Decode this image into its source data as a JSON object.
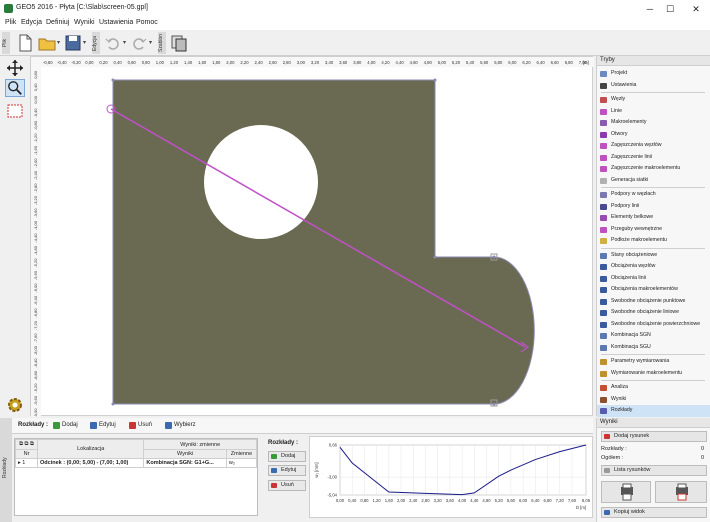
{
  "window": {
    "title": "GEO5 2016 - Płyta [C:\\Slab\\screen-05.gpl]",
    "minimize": "─",
    "maximize": "☐",
    "close": "✕"
  },
  "menu": [
    "Plik",
    "Edycja",
    "Definiuj",
    "Wyniki",
    "Ustawienia",
    "Pomoc"
  ],
  "toolbar": {
    "file_tab": "Plik",
    "edit_tab": "Edycja",
    "template_tab": "Szablon"
  },
  "ruler": {
    "top_ticks": [
      "-0,60",
      "-0,40",
      "-0,20",
      "0,00",
      "0,20",
      "0,40",
      "0,60",
      "0,80",
      "1,00",
      "1,20",
      "1,40",
      "1,60",
      "1,80",
      "2,00",
      "2,20",
      "2,40",
      "2,60",
      "2,80",
      "3,00",
      "3,20",
      "3,40",
      "3,60",
      "3,80",
      "4,00",
      "4,20",
      "4,40",
      "4,60",
      "4,80",
      "5,00",
      "5,20",
      "5,40",
      "5,60",
      "5,80",
      "6,00",
      "6,20",
      "6,40",
      "6,60",
      "6,80",
      "7,00"
    ],
    "top_unit": "[m]",
    "left_ticks": [
      "0,80",
      "0,40",
      "0,00",
      "-0,40",
      "-0,80",
      "-1,20",
      "-1,60",
      "-2,00",
      "-2,40",
      "-2,80",
      "-3,20",
      "-3,60",
      "-4,00",
      "-4,40",
      "-4,80",
      "-5,20",
      "-5,60",
      "-6,00",
      "-6,40",
      "-6,80",
      "-7,20",
      "-7,60",
      "-8,00",
      "-8,40",
      "-8,80",
      "-9,20",
      "-9,60",
      "-10,00"
    ]
  },
  "modes": {
    "header": "Tryby",
    "groups": [
      [
        {
          "label": "Projekt",
          "color": "#6a8ac4"
        },
        {
          "label": "Ustawienia",
          "color": "#444444"
        }
      ],
      [
        {
          "label": "Węzły",
          "color": "#c05050"
        },
        {
          "label": "Linie",
          "color": "#c050c0"
        },
        {
          "label": "Makroelementy",
          "color": "#8a5ab0"
        },
        {
          "label": "Otwory",
          "color": "#8a3ab0"
        },
        {
          "label": "Zagęszczenia węzłów",
          "color": "#c050c0"
        },
        {
          "label": "Zagęszczenie linii",
          "color": "#c050c0"
        },
        {
          "label": "Zagęszczenie makroelementu",
          "color": "#c050c0"
        },
        {
          "label": "Generacja siatki",
          "color": "#b0b0b0"
        }
      ],
      [
        {
          "label": "Podpory w węzłach",
          "color": "#7a7ab0"
        },
        {
          "label": "Podpory linii",
          "color": "#4a4a90"
        },
        {
          "label": "Elementy belkowe",
          "color": "#9a4ab0"
        },
        {
          "label": "Przeguby wewnętrzne",
          "color": "#c050c0"
        },
        {
          "label": "Podłoże makroelementu",
          "color": "#d0b040"
        }
      ],
      [
        {
          "label": "Stany obciążeniowe",
          "color": "#5a7ab0"
        },
        {
          "label": "Obciążenia węzłów",
          "color": "#3a5aa0"
        },
        {
          "label": "Obciążenia linii",
          "color": "#3a5aa0"
        },
        {
          "label": "Obciążenia makroelementów",
          "color": "#3a5aa0"
        },
        {
          "label": "Swobodne obciążenie punktowe",
          "color": "#3a5aa0"
        },
        {
          "label": "Swobodne obciążenie liniowe",
          "color": "#3a5aa0"
        },
        {
          "label": "Swobodne obciążenie powierzchniowe",
          "color": "#3a5aa0"
        },
        {
          "label": "Kombinacja SGN",
          "color": "#5a7ab0"
        },
        {
          "label": "Kombinacja SGU",
          "color": "#5a7ab0"
        }
      ],
      [
        {
          "label": "Parametry wymiarowania",
          "color": "#c09030"
        },
        {
          "label": "Wymiarowanie makroelementu",
          "color": "#c09030"
        }
      ],
      [
        {
          "label": "Analiza",
          "color": "#c05030"
        },
        {
          "label": "Wyniki",
          "color": "#8a5030"
        },
        {
          "label": "Rozkłady",
          "color": "#5a5ab0",
          "active": true
        }
      ]
    ]
  },
  "bottom": {
    "side_label": "Rozkłady",
    "toolbar": {
      "title": "Rozkłady :",
      "add": "Dodaj",
      "edit": "Edytuj",
      "delete": "Usuń",
      "select": "Wybierz"
    },
    "table": {
      "col_nr": "Nr",
      "col_location": "Lokalizacja",
      "col_results": "Wyniki: zmienne",
      "sub_results": "Wyniki",
      "sub_vars": "Zmienne",
      "rows": [
        {
          "nr": "1",
          "location": "Odcinek : (0,00; 5,00) - (7,00; 1,00)",
          "result": "Kombinacja SGN: G1+G...",
          "var": "w₂"
        }
      ]
    },
    "buttons_title": "Rozkłady :",
    "btn_add": "Dodaj",
    "btn_edit": "Edytuj",
    "btn_delete": "Usuń"
  },
  "chart_data": {
    "type": "line",
    "ylabel": "w₂ [mm]",
    "xlabel": "D [m]",
    "yticks": [
      "0,66",
      "-3,00",
      "-5,04"
    ],
    "ylim": [
      -5.04,
      0.66
    ],
    "xticks": [
      "0,00",
      "0,40",
      "0,80",
      "1,20",
      "1,60",
      "2,00",
      "2,40",
      "2,80",
      "3,20",
      "3,60",
      "4,00",
      "4,40",
      "4,80",
      "5,20",
      "5,60",
      "6,00",
      "6,40",
      "6,80",
      "7,20",
      "7,60",
      "8,06"
    ],
    "xlim": [
      0,
      8.06
    ],
    "series": [
      {
        "x": [
          0,
          0.4,
          1.6,
          2.8,
          4.0,
          4.4,
          5.2,
          5.6,
          6.4,
          7.2,
          8.06
        ],
        "values": [
          0.4,
          -1.4,
          -4.7,
          -4.85,
          -5.0,
          -4.8,
          -2.9,
          -2.2,
          -1.0,
          -0.1,
          0.66
        ]
      }
    ]
  },
  "results": {
    "header": "Wyniki",
    "add_image": "Dodaj rysunek",
    "count_label": "Rozkłady :",
    "count_value": "0",
    "total_label": "Ogółem :",
    "total_value": "0",
    "images_list": "Lista rysunków",
    "copy_view": "Kopiuj widok"
  }
}
